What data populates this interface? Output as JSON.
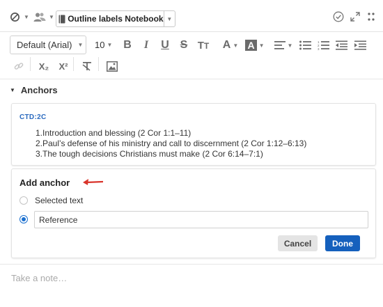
{
  "topbar": {
    "notebook_label": "Outline labels Notebook"
  },
  "toolbar": {
    "font": "Default (Arial)",
    "size": "10",
    "subscript_label": "X₂",
    "superscript_label": "X²"
  },
  "anchors": {
    "title": "Anchors",
    "reference_card": {
      "code": "CTD:2C",
      "lines": [
        "1.Introduction and blessing (2 Cor 1:1–11)",
        "2.Paul’s defense of his ministry and call to discernment (2 Cor 1:12–6:13)",
        "3.The tough decisions Christians must make (2 Cor 6:14–7:1)"
      ]
    },
    "add_anchor": {
      "title": "Add anchor",
      "option_selected_text": "Selected text",
      "reference_value": "Reference",
      "cancel_label": "Cancel",
      "done_label": "Done"
    }
  },
  "note": {
    "placeholder": "Take a note…"
  },
  "colors": {
    "accent": "#1560bd",
    "link": "#2a6abf",
    "annotation_arrow": "#d9342b"
  }
}
